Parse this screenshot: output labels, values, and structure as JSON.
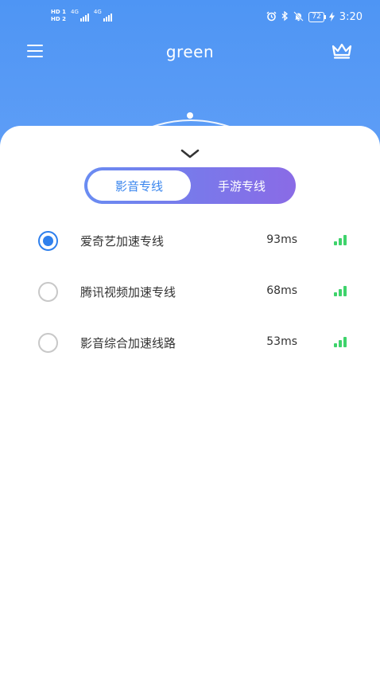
{
  "status_bar": {
    "hd_badges": [
      "HD 1",
      "HD 2"
    ],
    "network_labels": [
      "4G",
      "4G"
    ],
    "battery": "72",
    "time": "3:20",
    "icons": [
      "alarm-icon",
      "bluetooth-icon",
      "mute-icon",
      "battery-icon",
      "charging-icon"
    ]
  },
  "app_bar": {
    "title": "green",
    "menu_icon": "menu-icon",
    "vip_icon": "crown-icon"
  },
  "sheet": {
    "collapse_icon": "chevron-down-icon",
    "tabs": [
      {
        "label": "影音专线",
        "selected": true
      },
      {
        "label": "手游专线",
        "selected": false
      }
    ],
    "routes": [
      {
        "name": "爱奇艺加速专线",
        "ping": "93ms",
        "selected": true
      },
      {
        "name": "腾讯视频加速专线",
        "ping": "68ms",
        "selected": false
      },
      {
        "name": "影音综合加速线路",
        "ping": "53ms",
        "selected": false
      }
    ]
  },
  "colors": {
    "header": "#5b9bf5",
    "accent": "#2f80ed",
    "signal": "#3ed36b",
    "segment_start": "#6a8cf2",
    "segment_end": "#8a6be6"
  }
}
